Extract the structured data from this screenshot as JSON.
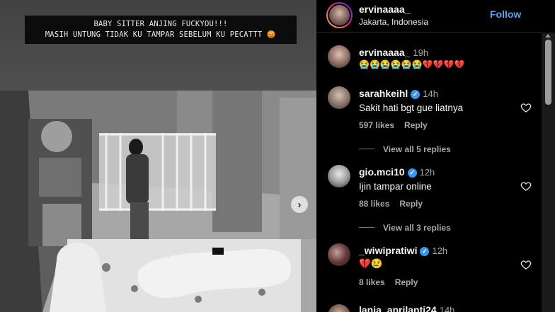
{
  "post": {
    "caption_line1": "BABY SITTER ANJING FUCKYOU!!!",
    "caption_line2": "MASIH UNTUNG TIDAK KU TAMPAR SEBELUM KU PECATTT 😡",
    "next_icon": "chevron-right-icon"
  },
  "header": {
    "username": "ervinaaaa_",
    "location": "Jakarta, Indonesia",
    "follow_label": "Follow"
  },
  "comments": [
    {
      "username": "ervinaaaa_",
      "time": "19h",
      "verified": false,
      "text": "😭😭😭😭😭😭💔💔💔💔",
      "likes": "",
      "reply": "",
      "view_replies": ""
    },
    {
      "username": "sarahkeihl",
      "time": "14h",
      "verified": true,
      "text": "Sakit hati bgt gue liatnya",
      "likes": "597 likes",
      "reply": "Reply",
      "view_replies": "View all 5 replies"
    },
    {
      "username": "gio.mci10",
      "time": "12h",
      "verified": true,
      "text": "Ijin tampar online",
      "likes": "88 likes",
      "reply": "Reply",
      "view_replies": "View all 3 replies"
    },
    {
      "username": "_wiwipratiwi",
      "time": "12h",
      "verified": true,
      "text": "💔😢",
      "likes": "8 likes",
      "reply": "Reply",
      "view_replies": ""
    },
    {
      "username": "lania_aprilanti24",
      "time": "14h",
      "verified": false,
      "text": "",
      "likes": "",
      "reply": "",
      "view_replies": ""
    }
  ]
}
